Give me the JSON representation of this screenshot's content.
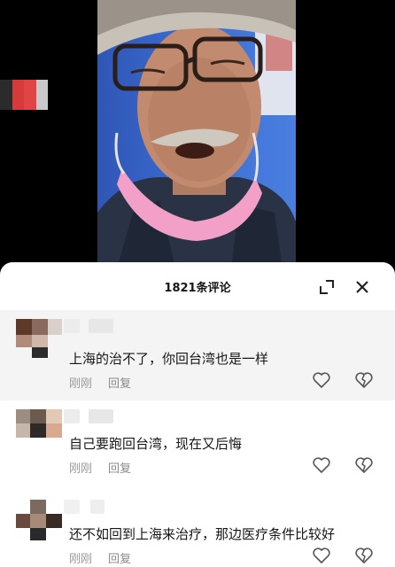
{
  "sheet": {
    "title": "1821条评论",
    "collapse_icon": "collapse-icon",
    "close_icon": "close-icon"
  },
  "comments": [
    {
      "text": "上海的治不了，你回台湾也是一样",
      "time": "刚刚",
      "reply": "回复"
    },
    {
      "text": "自己要跑回台湾，现在又后悔",
      "time": "刚刚",
      "reply": "回复"
    },
    {
      "text": "还不如回到上海来治疗，那边医疗条件比较好",
      "time": "刚刚",
      "reply": "回复"
    }
  ],
  "colors": {
    "video_background": "#3a6cd0",
    "mask": "#f3a0c8",
    "text": "#161616",
    "meta": "#9a9a9a",
    "highlight_row": "#f4f4f4"
  }
}
